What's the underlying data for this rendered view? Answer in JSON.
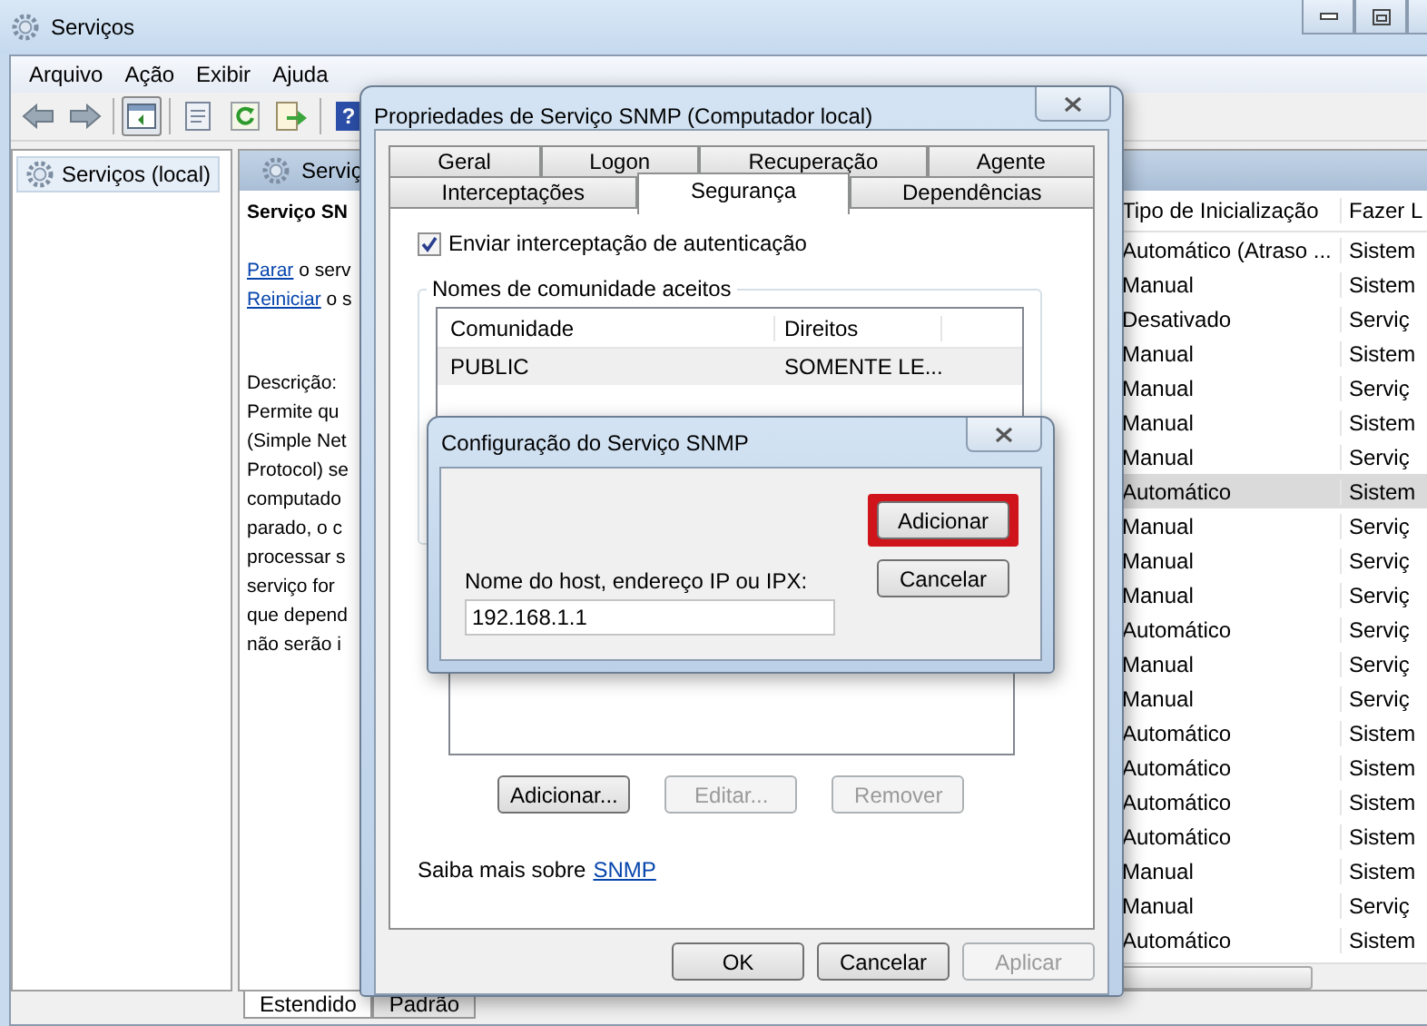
{
  "window": {
    "title": "Serviços"
  },
  "menu": [
    "Arquivo",
    "Ação",
    "Exibir",
    "Ajuda"
  ],
  "toolbar": [
    {
      "kind": "back",
      "pressed": false
    },
    {
      "kind": "forward",
      "pressed": false
    },
    {
      "kind": "separator"
    },
    {
      "kind": "tree",
      "pressed": true
    },
    {
      "kind": "separator"
    },
    {
      "kind": "properties",
      "pressed": false
    },
    {
      "kind": "refresh",
      "pressed": false
    },
    {
      "kind": "export",
      "pressed": false
    },
    {
      "kind": "separator"
    },
    {
      "kind": "help",
      "glyph": "?",
      "pressed": false
    }
  ],
  "tree": [
    {
      "label": "Serviços (local)",
      "selected": true
    }
  ],
  "pane": {
    "title": "Serviç",
    "service_name": "Serviço SN",
    "actions": [
      {
        "link": "Parar",
        "rest": "o serv"
      },
      {
        "link": "Reiniciar",
        "rest": "o s"
      }
    ],
    "description_label": "Descrição:",
    "description_lines": [
      "Permite qu",
      "(Simple Net",
      "Protocol) se",
      "computado",
      "parado, o c",
      "processar s",
      "serviço for",
      "que depend",
      "não serão i"
    ]
  },
  "services_table": {
    "columns": [
      "Tipo de Inicialização",
      "Fazer L"
    ],
    "rows": [
      {
        "cells": [
          "Automático (Atraso ...",
          "Sistem"
        ],
        "selected": false
      },
      {
        "cells": [
          "Manual",
          "Sistem"
        ],
        "selected": false
      },
      {
        "cells": [
          "Desativado",
          "Serviç"
        ],
        "selected": false
      },
      {
        "cells": [
          "Manual",
          "Sistem"
        ],
        "selected": false
      },
      {
        "cells": [
          "Manual",
          "Serviç"
        ],
        "selected": false
      },
      {
        "cells": [
          "Manual",
          "Sistem"
        ],
        "selected": false
      },
      {
        "cells": [
          "Manual",
          "Serviç"
        ],
        "selected": false
      },
      {
        "cells": [
          "Automático",
          "Sistem"
        ],
        "selected": true
      },
      {
        "cells": [
          "Manual",
          "Serviç"
        ],
        "selected": false
      },
      {
        "cells": [
          "Manual",
          "Serviç"
        ],
        "selected": false
      },
      {
        "cells": [
          "Manual",
          "Serviç"
        ],
        "selected": false
      },
      {
        "cells": [
          "Automático",
          "Serviç"
        ],
        "selected": false
      },
      {
        "cells": [
          "Manual",
          "Serviç"
        ],
        "selected": false
      },
      {
        "cells": [
          "Manual",
          "Serviç"
        ],
        "selected": false
      },
      {
        "cells": [
          "Automático",
          "Sistem"
        ],
        "selected": false
      },
      {
        "cells": [
          "Automático",
          "Sistem"
        ],
        "selected": false
      },
      {
        "cells": [
          "Automático",
          "Sistem"
        ],
        "selected": false
      },
      {
        "cells": [
          "Automático",
          "Sistem"
        ],
        "selected": false
      },
      {
        "cells": [
          "Manual",
          "Sistem"
        ],
        "selected": false
      },
      {
        "cells": [
          "Manual",
          "Serviç"
        ],
        "selected": false
      },
      {
        "cells": [
          "Automático",
          "Sistem"
        ],
        "selected": false
      }
    ]
  },
  "view_tabs": [
    {
      "label": "Estendido",
      "selected": true
    },
    {
      "label": "Padrão",
      "selected": false
    }
  ],
  "properties_dialog": {
    "title": "Propriedades de Serviço SNMP (Computador local)",
    "tab_rows": [
      [
        {
          "label": "Geral",
          "selected": false
        },
        {
          "label": "Logon",
          "selected": false
        },
        {
          "label": "Recuperação",
          "selected": false
        },
        {
          "label": "Agente",
          "selected": false
        }
      ],
      [
        {
          "label": "Interceptações",
          "selected": false
        },
        {
          "label": "Segurança",
          "selected": true
        },
        {
          "label": "Dependências",
          "selected": false
        }
      ]
    ],
    "auth_trap": {
      "label": "Enviar interceptação de autenticação",
      "checked": true
    },
    "community_group": {
      "title": "Nomes de comunidade aceitos",
      "columns": [
        "Comunidade",
        "Direitos"
      ],
      "rows": [
        {
          "cells": [
            "PUBLIC",
            "SOMENTE LE..."
          ]
        }
      ]
    },
    "host_buttons": [
      {
        "label": "Adicionar...",
        "disabled": false
      },
      {
        "label": "Editar...",
        "disabled": true
      },
      {
        "label": "Remover",
        "disabled": true
      }
    ],
    "more_info": {
      "text": "Saiba mais sobre",
      "link": "SNMP"
    },
    "buttons": [
      {
        "label": "OK",
        "disabled": false
      },
      {
        "label": "Cancelar",
        "disabled": false
      },
      {
        "label": "Aplicar",
        "disabled": true
      }
    ]
  },
  "config_dialog": {
    "title": "Configuração do Serviço SNMP",
    "buttons": [
      {
        "label": "Adicionar",
        "highlighted": true
      },
      {
        "label": "Cancelar",
        "highlighted": false
      }
    ],
    "host_field": {
      "label": "Nome do host, endereço IP ou IPX:",
      "value": "192.168.1.1"
    }
  }
}
